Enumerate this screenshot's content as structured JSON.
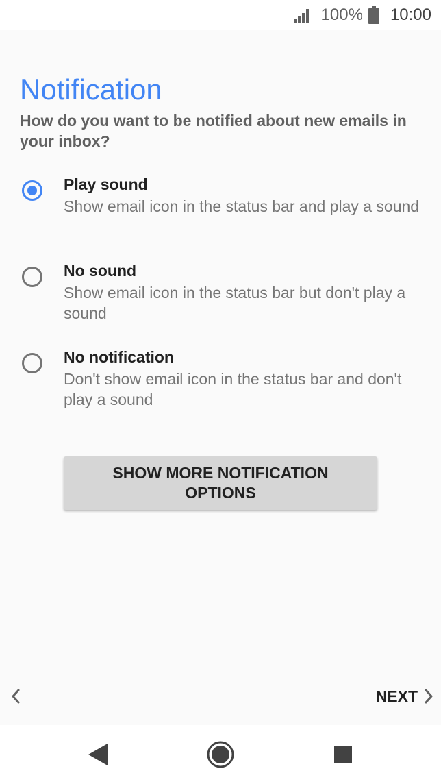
{
  "status_bar": {
    "battery_percent": "100%",
    "time": "10:00",
    "icons": [
      "signal-icon",
      "battery-icon"
    ]
  },
  "page": {
    "title": "Notification",
    "question": "How do you want to be notified about new emails in your inbox?"
  },
  "options": [
    {
      "title": "Play sound",
      "description": "Show email icon in the status bar and play a sound",
      "selected": true
    },
    {
      "title": "No sound",
      "description": "Show email icon in the status bar but don't play a sound",
      "selected": false
    },
    {
      "title": "No notification",
      "description": "Don't show email icon in the status bar and don't play a sound",
      "selected": false
    }
  ],
  "more_button": {
    "label": "SHOW MORE NOTIFICATION OPTIONS"
  },
  "footer": {
    "back_icon": "chevron-left-icon",
    "next_label": "NEXT",
    "next_icon": "chevron-right-icon"
  },
  "nav_bar": {
    "icons": [
      "back-triangle-icon",
      "home-circle-icon",
      "recents-square-icon"
    ]
  },
  "colors": {
    "accent": "#4285f4",
    "background": "#fafafa",
    "button": "#d6d6d6"
  }
}
